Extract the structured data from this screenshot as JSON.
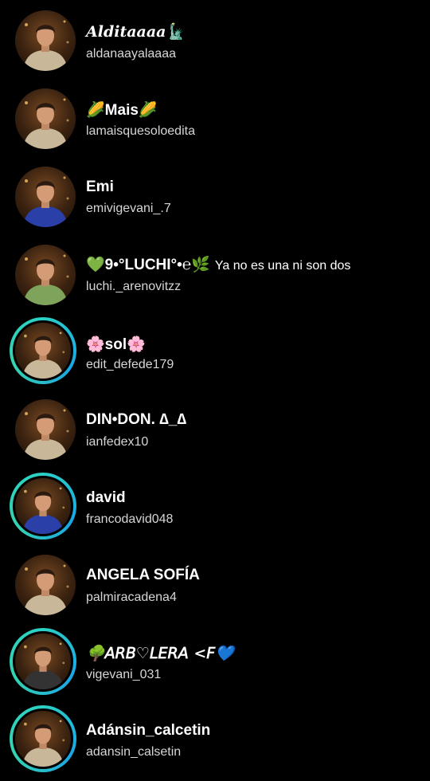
{
  "contacts": [
    {
      "name": "𝑨𝒍𝒅𝒊𝒕𝒂𝒂𝒂𝒂",
      "name_icon": "🗽",
      "username": "aldanaayalaaaa",
      "ring": false,
      "shirt": "#c9b79a"
    },
    {
      "name_pre": "🌽",
      "name": "Mais",
      "name_post": "🌽",
      "username": "lamaisquesoloedita",
      "ring": false,
      "shirt": "#c9b79a"
    },
    {
      "name": "Emi",
      "username": "emivigevani_.7",
      "ring": false,
      "shirt": "#2b3fa8"
    },
    {
      "name_pre": "💚",
      "name": "9•°LUCHI°•℮",
      "name_post": "🌿",
      "note": "Ya no es una ni son dos",
      "username": "luchi._arenovitzz",
      "ring": false,
      "shirt": "#7fa35a"
    },
    {
      "name_pre": "🌸",
      "name": "sol",
      "name_post": "🌸",
      "username": "edit_defede179",
      "ring": true,
      "shirt": "#c9b79a"
    },
    {
      "name": "DIN•DON. ∆_∆",
      "username": "ianfedex10",
      "ring": false,
      "shirt": "#c9b79a"
    },
    {
      "name": "david",
      "username": "francodavid048",
      "ring": true,
      "shirt": "#2b3fa8"
    },
    {
      "name": "ANGELA SOFÍA",
      "username": "palmiracadena4",
      "ring": false,
      "shirt": "#c9b79a"
    },
    {
      "name_pre": "🌳",
      "name": "𝘈𝘙𝘉♡𝘓𝘌𝘙𝘈  <𝘍",
      "name_post": "💙",
      "username": "vigevani_031",
      "ring": true,
      "shirt": "#333333"
    },
    {
      "name": "Adánsin_calcetin",
      "username": "adansin_calsetin",
      "ring": true,
      "shirt": "#c9b79a"
    }
  ]
}
